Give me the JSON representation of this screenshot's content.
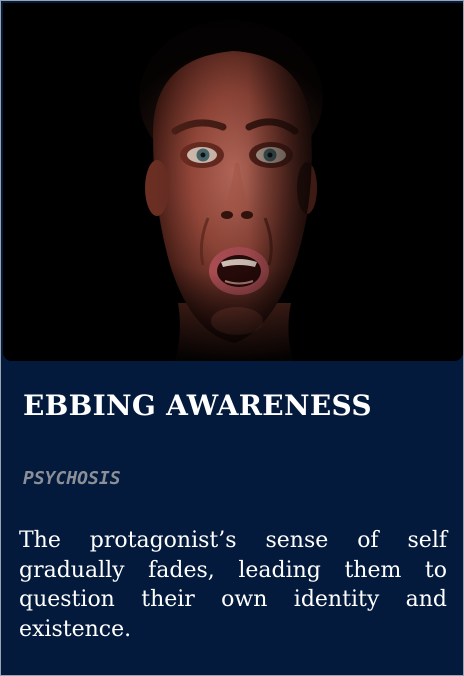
{
  "card": {
    "image_alt": "Close-up of a frightened man's face emerging from darkness",
    "title": "EBBING AWARENESS",
    "category": "PSYCHOSIS",
    "description": "The protagonist’s sense of self gradually fades, leading them to question their own identity and existence."
  },
  "colors": {
    "card_background": "#031a3c",
    "title": "#ffffff",
    "category": "#8b8f98",
    "description": "#ffffff"
  }
}
